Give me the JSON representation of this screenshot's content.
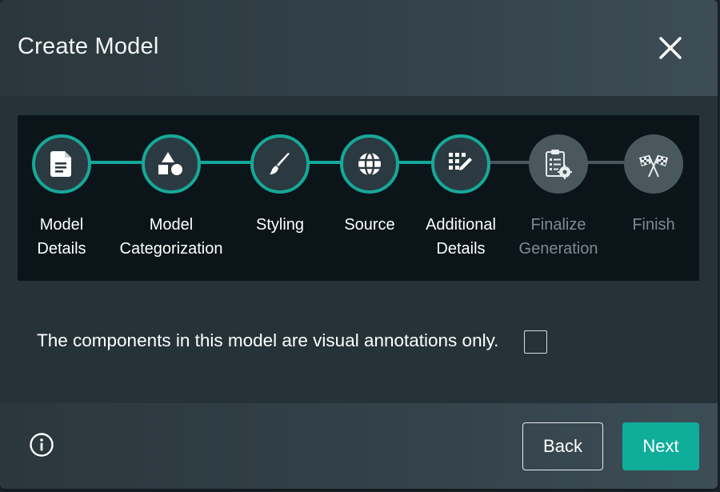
{
  "modal": {
    "title": "Create Model"
  },
  "stepper": {
    "steps": [
      {
        "line1": "Model",
        "line2": "Details",
        "icon": "document-icon",
        "state": "completed"
      },
      {
        "line1": "Model",
        "line2": "Categorization",
        "icon": "shapes-icon",
        "state": "completed"
      },
      {
        "line1": "Styling",
        "line2": "",
        "icon": "paintbrush-icon",
        "state": "completed"
      },
      {
        "line1": "Source",
        "line2": "",
        "icon": "globe-icon",
        "state": "completed"
      },
      {
        "line1": "Additional",
        "line2": "Details",
        "icon": "grid-edit-icon",
        "state": "current"
      },
      {
        "line1": "Finalize",
        "line2": "Generation",
        "icon": "clipboard-gear-icon",
        "state": "pending"
      },
      {
        "line1": "Finish",
        "line2": "",
        "icon": "checkered-flags-icon",
        "state": "pending"
      }
    ]
  },
  "content": {
    "annotation_label": "The components in this model are visual annotations only.",
    "annotation_checked": false
  },
  "footer": {
    "back_label": "Back",
    "next_label": "Next"
  },
  "colors": {
    "accent": "#0fae9b",
    "step_border": "#16a899",
    "inactive_step": "#4a585e",
    "pending_text": "#7d8a8f"
  }
}
